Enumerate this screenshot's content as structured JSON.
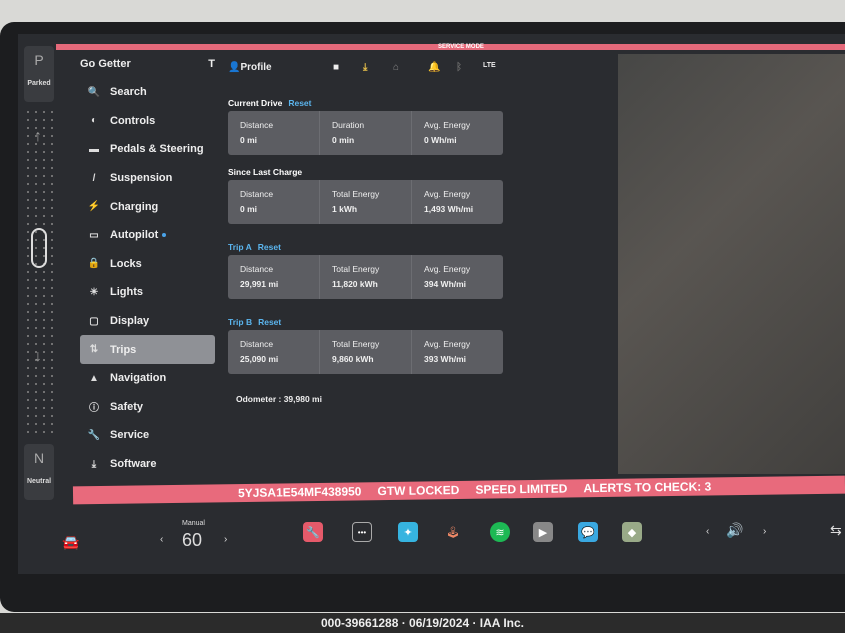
{
  "service_mode": "SERVICE MODE",
  "gear": {
    "top": "P",
    "top_label": "Parked",
    "bottom": "N",
    "bottom_label": "Neutral"
  },
  "sidebar": {
    "profile_name": "Go Getter",
    "items": [
      {
        "label": "Search",
        "icon": "search-icon",
        "glyph": "🔍"
      },
      {
        "label": "Controls",
        "icon": "toggle-icon",
        "glyph": "◐"
      },
      {
        "label": "Pedals & Steering",
        "icon": "car-icon",
        "glyph": "▬"
      },
      {
        "label": "Suspension",
        "icon": "suspension-icon",
        "glyph": "/"
      },
      {
        "label": "Charging",
        "icon": "bolt-icon",
        "glyph": "⚡"
      },
      {
        "label": "Autopilot",
        "icon": "autopilot-icon",
        "glyph": "▭"
      },
      {
        "label": "Locks",
        "icon": "lock-icon",
        "glyph": "🔒"
      },
      {
        "label": "Lights",
        "icon": "sun-icon",
        "glyph": "☀"
      },
      {
        "label": "Display",
        "icon": "display-icon",
        "glyph": "▢"
      },
      {
        "label": "Trips",
        "icon": "trips-icon",
        "glyph": "⇅"
      },
      {
        "label": "Navigation",
        "icon": "navigation-icon",
        "glyph": "▲"
      },
      {
        "label": "Safety",
        "icon": "safety-icon",
        "glyph": "ⓘ"
      },
      {
        "label": "Service",
        "icon": "wrench-icon",
        "glyph": "🔧"
      },
      {
        "label": "Software",
        "icon": "download-icon",
        "glyph": "⤓"
      }
    ],
    "active": "Trips"
  },
  "topbar": {
    "profile": "Profile",
    "lte": "LTE"
  },
  "trips": {
    "current_drive": {
      "title": "Current Drive",
      "reset": "Reset",
      "cells": [
        {
          "label": "Distance",
          "value": "0 mi"
        },
        {
          "label": "Duration",
          "value": "0 min"
        },
        {
          "label": "Avg. Energy",
          "value": "0 Wh/mi"
        }
      ]
    },
    "since_last_charge": {
      "title": "Since Last Charge",
      "cells": [
        {
          "label": "Distance",
          "value": "0 mi"
        },
        {
          "label": "Total Energy",
          "value": "1 kWh"
        },
        {
          "label": "Avg. Energy",
          "value": "1,493 Wh/mi"
        }
      ]
    },
    "trip_a": {
      "title": "Trip A",
      "reset": "Reset",
      "cells": [
        {
          "label": "Distance",
          "value": "29,991 mi"
        },
        {
          "label": "Total Energy",
          "value": "11,820 kWh"
        },
        {
          "label": "Avg. Energy",
          "value": "394 Wh/mi"
        }
      ]
    },
    "trip_b": {
      "title": "Trip B",
      "reset": "Reset",
      "cells": [
        {
          "label": "Distance",
          "value": "25,090 mi"
        },
        {
          "label": "Total Energy",
          "value": "9,860 kWh"
        },
        {
          "label": "Avg. Energy",
          "value": "393 Wh/mi"
        }
      ]
    },
    "odometer": "Odometer : 39,980 mi"
  },
  "alert_bar": [
    "5YJSA1E54MF438950",
    "GTW LOCKED",
    "SPEED LIMITED",
    "ALERTS TO CHECK: 3"
  ],
  "dock": {
    "climate_mode": "Manual",
    "temperature": "60"
  },
  "caption": "000-39661288 · 06/19/2024 · IAA Inc."
}
